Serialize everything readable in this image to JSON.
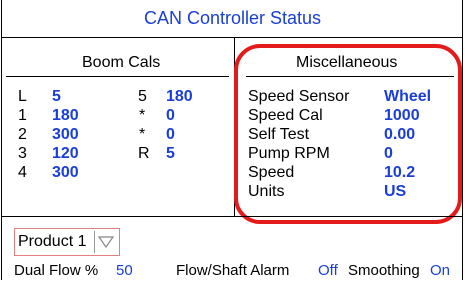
{
  "title": "CAN Controller Status",
  "boom_cals": {
    "heading": "Boom Cals",
    "left": [
      {
        "label": "L",
        "value": "5"
      },
      {
        "label": "1",
        "value": "180"
      },
      {
        "label": "2",
        "value": "300"
      },
      {
        "label": "3",
        "value": "120"
      },
      {
        "label": "4",
        "value": "300"
      }
    ],
    "right": [
      {
        "label": "5",
        "value": "180"
      },
      {
        "label": "*",
        "value": "0"
      },
      {
        "label": "*",
        "value": "0"
      },
      {
        "label": "R",
        "value": "5"
      }
    ]
  },
  "misc": {
    "heading": "Miscellaneous",
    "rows": [
      {
        "label": "Speed Sensor",
        "value": "Wheel"
      },
      {
        "label": "Speed Cal",
        "value": "1000"
      },
      {
        "label": "Self Test",
        "value": "0.00"
      },
      {
        "label": "Pump RPM",
        "value": "0"
      },
      {
        "label": "Speed",
        "value": "10.2"
      },
      {
        "label": "Units",
        "value": "US"
      }
    ]
  },
  "product_select": {
    "selected": "Product 1"
  },
  "bottom": {
    "dual_flow_label": "Dual Flow %",
    "dual_flow_value": "50",
    "alarm_label": "Flow/Shaft Alarm",
    "alarm_value": "Off",
    "smoothing_label": "Smoothing",
    "smoothing_value": "On"
  },
  "colors": {
    "value_blue": "#1a3ed9",
    "highlight_red": "#e41b1b"
  }
}
